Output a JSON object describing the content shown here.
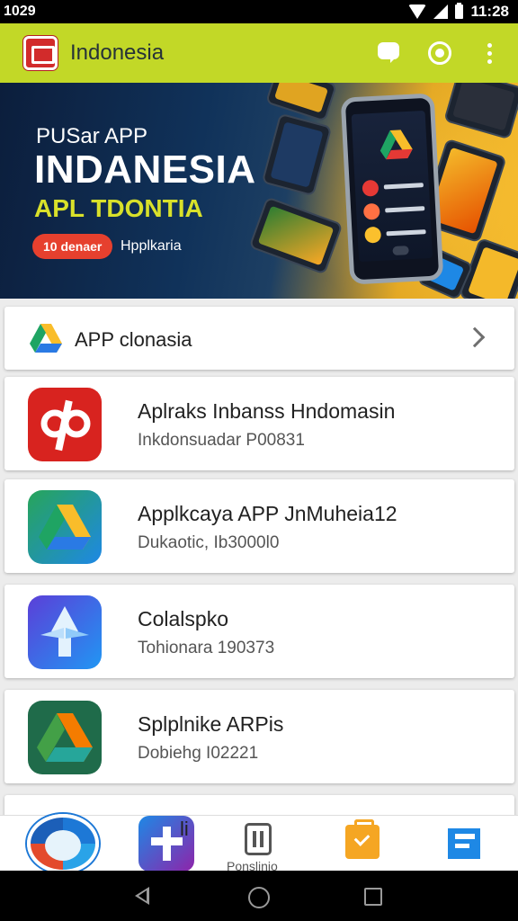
{
  "status_bar": {
    "left_text": "1029",
    "time": "11:28"
  },
  "app_bar": {
    "title": "Indonesia"
  },
  "banner": {
    "line1": "PUSar APP",
    "line2": "INDANESIA",
    "line3": "APL TDONTIA",
    "badge": "10 denaer",
    "note": "Hpplkaria"
  },
  "section": {
    "label": "APP clonasia"
  },
  "apps": [
    {
      "name": "Aplraks Inbanss Hndomasin",
      "sub": "Inkdonsuadar P00831"
    },
    {
      "name": "Applkcaya APP JnMuheia12",
      "sub": "Dukaotic, Ib3000l0"
    },
    {
      "name": "Colalspko",
      "sub": "Tohionara 190373"
    },
    {
      "name": "Splplnike ARPis",
      "sub": "Dobiehg I02221"
    },
    {
      "name": "li",
      "sub": ""
    }
  ],
  "bottom_nav": {
    "partial_label": "li",
    "pause_label": "Ponslinio"
  },
  "colors": {
    "app_bar": "#c2d827",
    "accent_red": "#e6402e",
    "banner_yellow": "#d9e12a"
  }
}
